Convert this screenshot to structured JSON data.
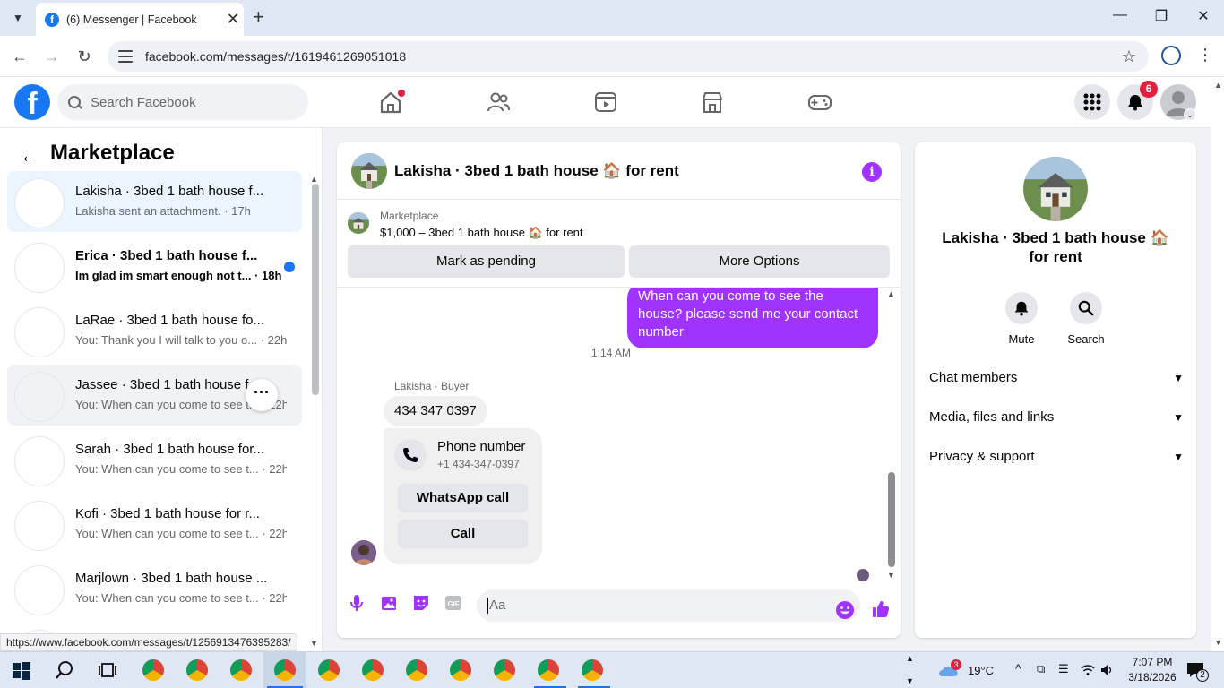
{
  "browser": {
    "tab_title": "(6) Messenger | Facebook",
    "url": "facebook.com/messages/t/1619461269051018",
    "status_url": "https://www.facebook.com/messages/t/1256913476395283/"
  },
  "fb": {
    "search_placeholder": "Search Facebook",
    "notification_count": "6",
    "logo_letter": "f"
  },
  "left": {
    "title": "Marketplace",
    "conversations": [
      {
        "name": "Lakisha · 3bed 1 bath house  f...",
        "snippet": "Lakisha sent an attachment. · 17h",
        "state": "active"
      },
      {
        "name": "Erica · 3bed 1 bath house  f...",
        "snippet": "Im glad im smart enough not t... · 18h",
        "state": "unread"
      },
      {
        "name": "LaRae · 3bed 1 bath house  fo...",
        "snippet": "You: Thank you I will talk to you o... · 22h",
        "state": "normal"
      },
      {
        "name": "Jassee · 3bed 1 bath house  f...",
        "snippet": "You: When can you come to see t... · 22h",
        "state": "hover"
      },
      {
        "name": "Sarah · 3bed 1 bath house  for...",
        "snippet": "You: When can you come to see t... · 22h",
        "state": "normal"
      },
      {
        "name": "Kofi · 3bed 1 bath house  for r...",
        "snippet": "You: When can you come to see t... · 22h",
        "state": "normal"
      },
      {
        "name": "Marjlown · 3bed 1 bath house ...",
        "snippet": "You: When can you come to see t... · 22h",
        "state": "normal"
      }
    ]
  },
  "chat": {
    "title": "Lakisha · 3bed 1 bath house 🏠 for rent",
    "marketplace_label": "Marketplace",
    "listing": "$1,000 – 3bed 1 bath house 🏠 for rent",
    "btn_pending": "Mark as pending",
    "btn_options": "More Options",
    "sent_message": "When can you come to see the house? please send me  your contact number",
    "timestamp": "1:14 AM",
    "sender_label": "Lakisha · Buyer",
    "received_message": "434 347 0397",
    "phone_card_title": "Phone number",
    "phone_card_number": "+1 434-347-0397",
    "btn_whatsapp": "WhatsApp call",
    "btn_call": "Call",
    "input_placeholder": "Aa",
    "accent_color": "#a033ff"
  },
  "right": {
    "name": "Lakisha · 3bed 1 bath house 🏠 for rent",
    "mute_label": "Mute",
    "search_label": "Search",
    "sections": [
      "Chat members",
      "Media, files and links",
      "Privacy & support"
    ]
  },
  "taskbar": {
    "weather_temp": "19°C",
    "weather_badge": "3",
    "time": "7:07 PM",
    "date": "3/18/2026",
    "notification_count": "2"
  }
}
